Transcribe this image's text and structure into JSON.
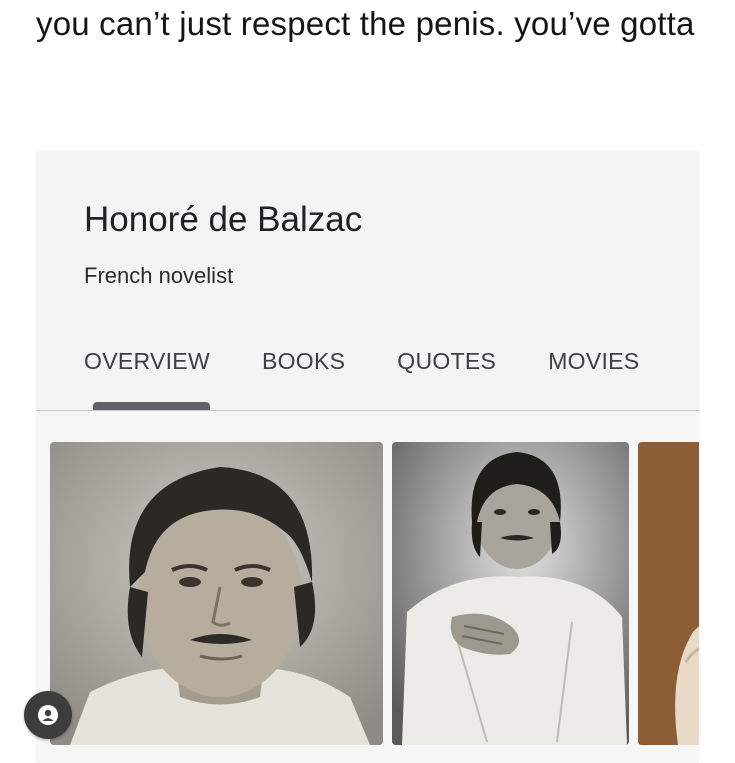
{
  "caption": {
    "text": "you can’t just respect the penis. you’ve gotta"
  },
  "knowledge_card": {
    "title": "Honoré de Balzac",
    "subtitle": "French novelist",
    "tabs": [
      {
        "label": "OVERVIEW",
        "selected": true
      },
      {
        "label": "BOOKS",
        "selected": false
      },
      {
        "label": "QUOTES",
        "selected": false
      },
      {
        "label": "MOVIES",
        "selected": false
      }
    ],
    "photos": [
      {
        "icon": "portrait-photo"
      },
      {
        "icon": "portrait-photo"
      },
      {
        "icon": "painting-photo"
      }
    ]
  },
  "badge": {
    "icon": "user-avatar-icon"
  },
  "colors": {
    "card_background": "#f4f4f4",
    "tab_indicator": "#5f6368",
    "title_text": "#202124",
    "badge_background": "#3c3c3c"
  }
}
